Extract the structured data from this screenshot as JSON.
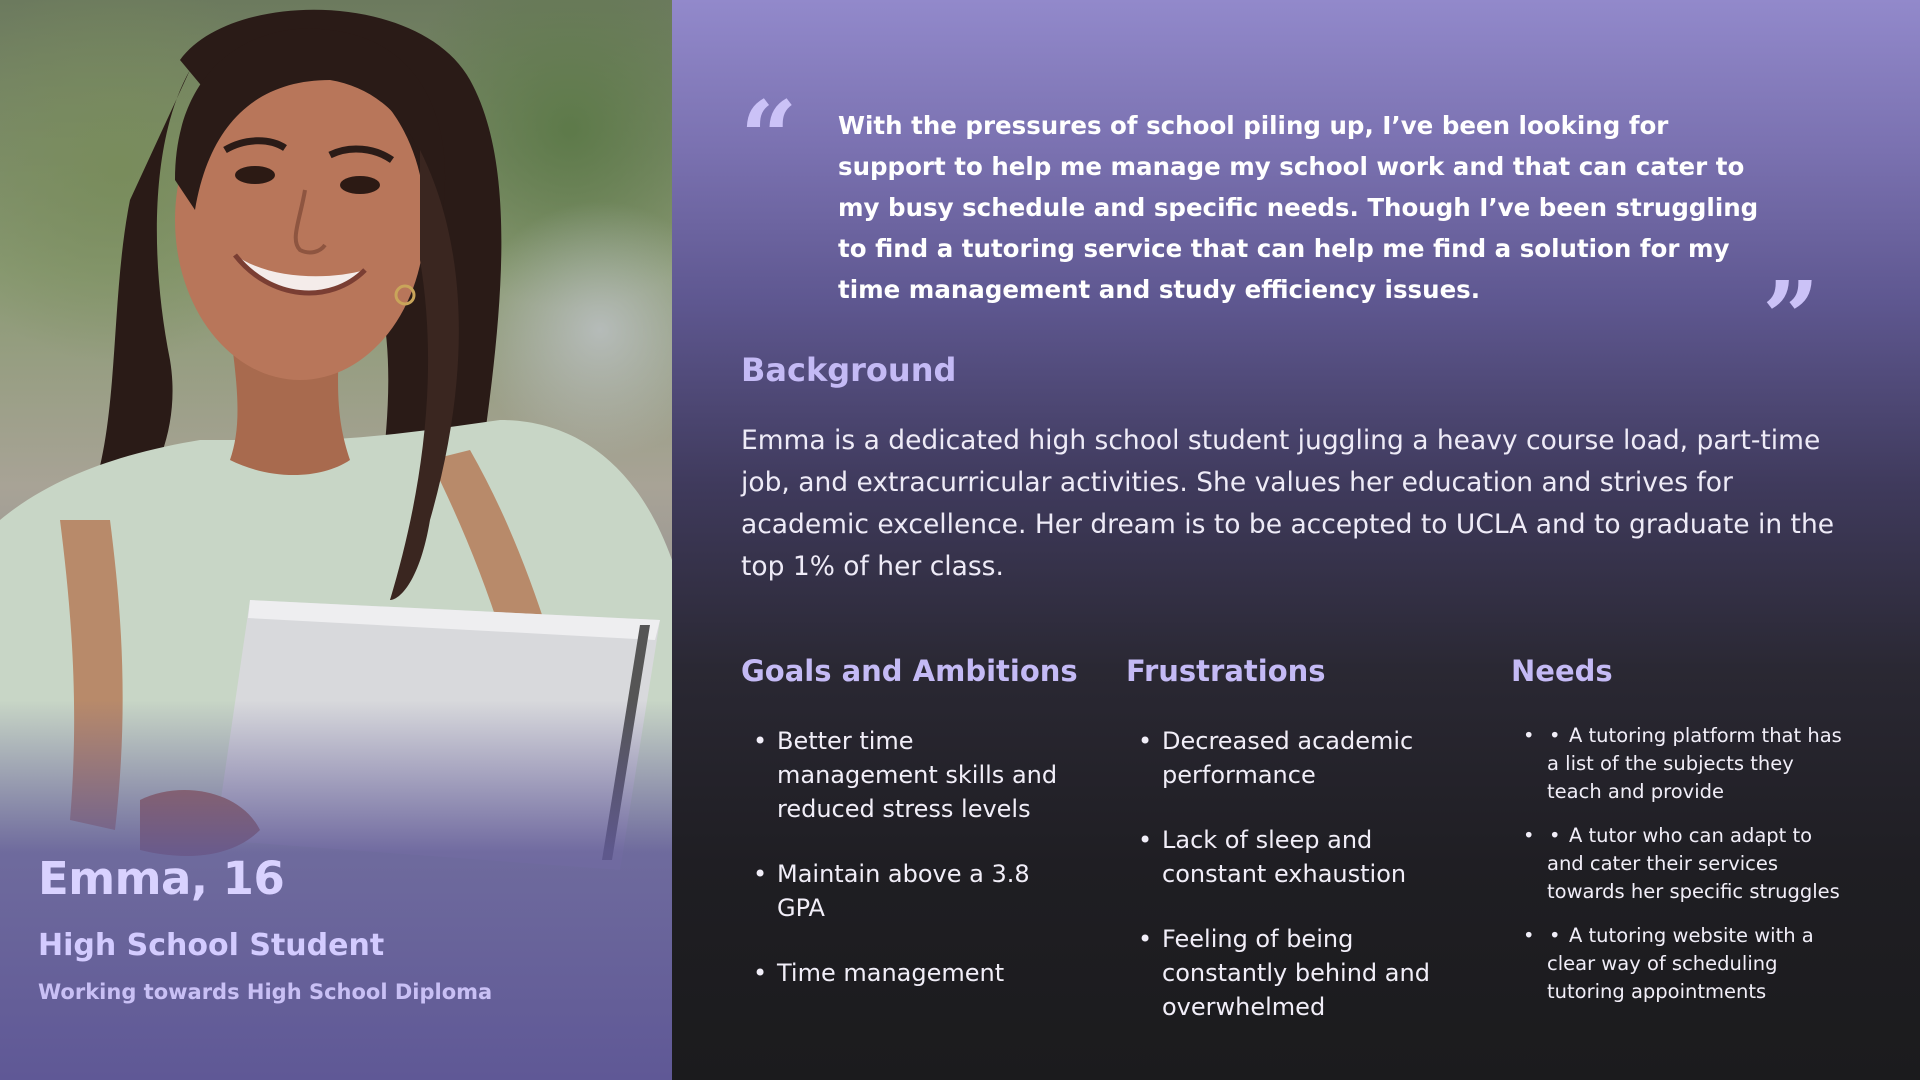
{
  "persona": {
    "name": "Emma, 16",
    "role": "High School Student",
    "subtitle": "Working towards High School Diploma"
  },
  "quote": {
    "open_mark": "“",
    "close_mark": "”",
    "text": "With the pressures of school piling up, I’ve been looking for support to help me manage my school work and that can cater to my busy schedule and specific needs. Though I’ve been struggling to find a tutoring service that can help me find a solution for my time management and study efficiency issues."
  },
  "background": {
    "title": "Background",
    "text": "Emma is a dedicated high school student juggling a heavy course load, part-time job, and extracurricular activities. She values her education and strives for academic excellence. Her dream is to be accepted to UCLA and to graduate in the top 1% of her class."
  },
  "goals": {
    "title": "Goals and Ambitions",
    "items": [
      "Better time management skills and reduced stress levels",
      "Maintain above a 3.8 GPA",
      "Time management"
    ]
  },
  "frustrations": {
    "title": "Frustrations",
    "items": [
      "Decreased academic performance",
      "Lack of sleep and constant exhaustion",
      "Feeling of being constantly behind and overwhelmed"
    ]
  },
  "needs": {
    "title": "Needs",
    "bullet": "•",
    "items": [
      "A tutoring platform that has a list of the subjects they teach and provide",
      "A tutor who can adapt to and cater their services towards her specific struggles",
      "A tutoring website with a clear way of scheduling tutoring appointments"
    ]
  },
  "colors": {
    "accent": "#c4baf5",
    "panel_top": "#9289cb",
    "panel_bottom": "#1b1b1d",
    "photo_overlay": "#5f5896"
  }
}
